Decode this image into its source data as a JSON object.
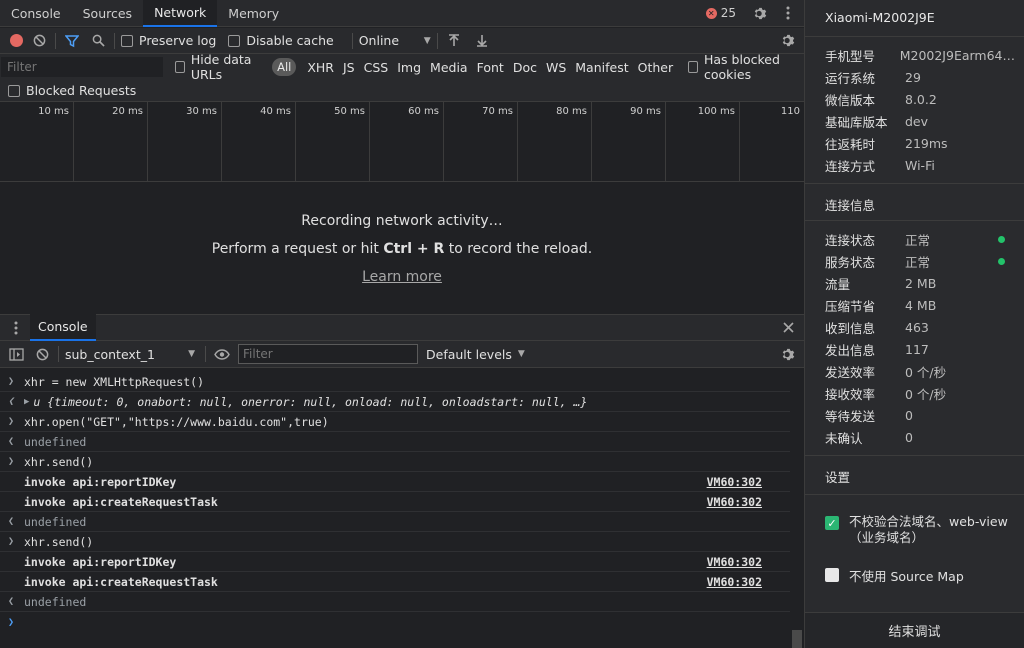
{
  "tabs": [
    {
      "label": "Console"
    },
    {
      "label": "Sources"
    },
    {
      "label": "Network"
    },
    {
      "label": "Memory"
    }
  ],
  "error_count": "25",
  "toolbar": {
    "preserve_log": "Preserve log",
    "disable_cache": "Disable cache",
    "throttle": "Online"
  },
  "filterbar": {
    "placeholder": "Filter",
    "hide_data_urls": "Hide data URLs",
    "types": [
      "All",
      "XHR",
      "JS",
      "CSS",
      "Img",
      "Media",
      "Font",
      "Doc",
      "WS",
      "Manifest",
      "Other"
    ],
    "has_blocked_cookies": "Has blocked cookies",
    "blocked_requests": "Blocked Requests"
  },
  "timeline": {
    "ticks": [
      "10 ms",
      "20 ms",
      "30 ms",
      "40 ms",
      "50 ms",
      "60 ms",
      "70 ms",
      "80 ms",
      "90 ms",
      "100 ms",
      "110"
    ]
  },
  "empty": {
    "line1": "Recording network activity…",
    "line2_pre": "Perform a request or hit ",
    "line2_key": "Ctrl + R",
    "line2_post": " to record the reload.",
    "learn_more": "Learn more"
  },
  "drawer": {
    "tab": "Console",
    "context": "sub_context_1",
    "filter_placeholder": "Filter",
    "levels": "Default levels"
  },
  "console_lines": {
    "l1": "xhr = new XMLHttpRequest()",
    "l2": "u {timeout: 0, onabort: null, onerror: null, onload: null, onloadstart: null, …}",
    "l3": "xhr.open(\"GET\",\"https://www.baidu.com\",true)",
    "l4": "undefined",
    "l5": "xhr.send()",
    "l6": "invoke api:reportIDKey",
    "l7": "invoke api:createRequestTask",
    "l8": "undefined",
    "l9": "xhr.send()",
    "l10": "invoke api:reportIDKey",
    "l11": "invoke api:createRequestTask",
    "l12": "undefined",
    "src": "VM60:302"
  },
  "side": {
    "device": "Xiaomi-M2002J9E",
    "info": [
      {
        "k": "手机型号",
        "v": "M2002J9Earm64…"
      },
      {
        "k": "运行系统",
        "v": "29"
      },
      {
        "k": "微信版本",
        "v": "8.0.2"
      },
      {
        "k": "基础库版本",
        "v": "dev"
      },
      {
        "k": "往返耗时",
        "v": "219ms"
      },
      {
        "k": "连接方式",
        "v": "Wi-Fi"
      }
    ],
    "conn_title": "连接信息",
    "conn": [
      {
        "k": "连接状态",
        "v": "正常"
      },
      {
        "k": "服务状态",
        "v": "正常"
      },
      {
        "k": "流量",
        "v": "2 MB"
      },
      {
        "k": "压缩节省",
        "v": "4 MB"
      },
      {
        "k": "收到信息",
        "v": "463"
      },
      {
        "k": "发出信息",
        "v": "117"
      },
      {
        "k": "发送效率",
        "v": "0 个/秒"
      },
      {
        "k": "接收效率",
        "v": "0 个/秒"
      },
      {
        "k": "等待发送",
        "v": "0"
      },
      {
        "k": "未确认",
        "v": "0"
      }
    ],
    "settings_title": "设置",
    "setting1": "不校验合法域名、web-view（业务域名）",
    "setting2": "不使用 Source Map",
    "end_button": "结束调试",
    "status_color": "#23c36a"
  }
}
